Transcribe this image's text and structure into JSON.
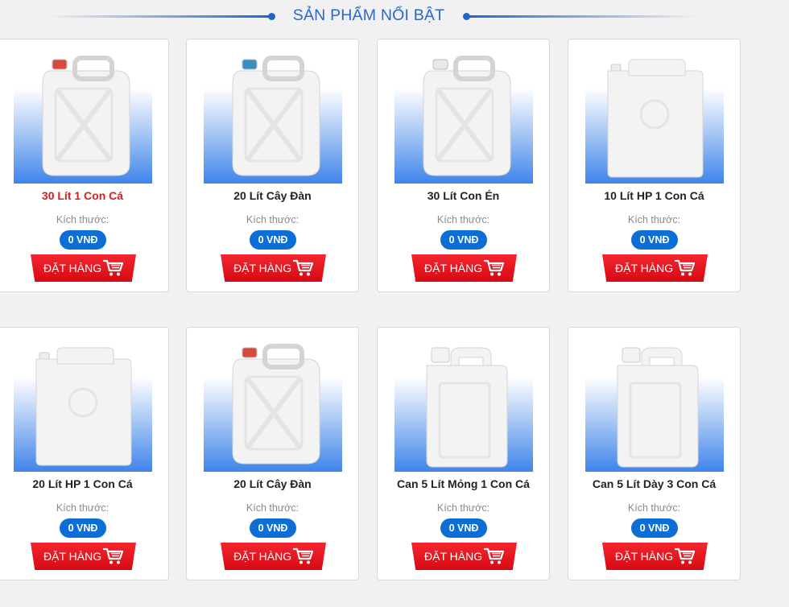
{
  "section": {
    "title": "SẢN PHẨM NỔI BẬT"
  },
  "common": {
    "size_label": "Kích thước:",
    "order_label": "ĐẶT HÀNG"
  },
  "products": [
    {
      "name": "30 Lít 1 Con Cá",
      "price": "0 VNĐ",
      "cap_color": "#d94a3e",
      "highlighted": true
    },
    {
      "name": "20 Lít Cây Đàn",
      "price": "0 VNĐ",
      "cap_color": "#3a8fc0",
      "highlighted": false
    },
    {
      "name": "30 Lít Con Én",
      "price": "0 VNĐ",
      "cap_color": "#e8e8e8",
      "highlighted": false
    },
    {
      "name": "10 Lít HP 1 Con Cá",
      "price": "0 VNĐ",
      "cap_color": "#eeeeee",
      "highlighted": false
    },
    {
      "name": "20 Lít HP 1 Con Cá",
      "price": "0 VNĐ",
      "cap_color": "#eeeeee",
      "highlighted": false
    },
    {
      "name": "20 Lít Cây Đàn",
      "price": "0 VNĐ",
      "cap_color": "#d94a3e",
      "highlighted": false
    },
    {
      "name": "Can 5 Lít Mỏng 1 Con Cá",
      "price": "0 VNĐ",
      "cap_color": "#f2f2f2",
      "highlighted": false
    },
    {
      "name": "Can 5 Lít Dày 3 Con Cá",
      "price": "0 VNĐ",
      "cap_color": "#f2f2f2",
      "highlighted": false
    }
  ],
  "colors": {
    "accent": "#1f64c8",
    "price_badge": "#0d6fd6",
    "order_button": "#e3111b",
    "highlight_name": "#e01919"
  }
}
